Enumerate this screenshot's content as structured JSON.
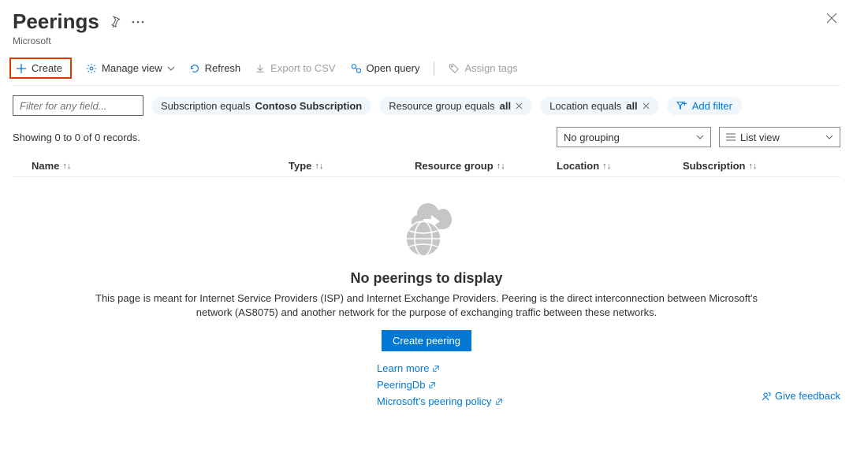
{
  "header": {
    "title": "Peerings",
    "subtitle": "Microsoft"
  },
  "toolbar": {
    "create": "Create",
    "manage_view": "Manage view",
    "refresh": "Refresh",
    "export_csv": "Export to CSV",
    "open_query": "Open query",
    "assign_tags": "Assign tags"
  },
  "filters": {
    "input_placeholder": "Filter for any field...",
    "subscription_prefix": "Subscription equals ",
    "subscription_value": "Contoso Subscription",
    "rg_prefix": "Resource group equals ",
    "rg_value": "all",
    "loc_prefix": "Location equals ",
    "loc_value": "all",
    "add_filter": "Add filter"
  },
  "controls": {
    "records_text": "Showing 0 to 0 of 0 records.",
    "grouping": "No grouping",
    "view": "List view"
  },
  "columns": {
    "name": "Name",
    "type": "Type",
    "rg": "Resource group",
    "location": "Location",
    "subscription": "Subscription"
  },
  "empty": {
    "title": "No peerings to display",
    "desc": "This page is meant for Internet Service Providers (ISP) and Internet Exchange Providers. Peering is the direct interconnection between Microsoft's network (AS8075) and another network for the purpose of exchanging traffic between these networks.",
    "cta": "Create peering",
    "learn_more": "Learn more",
    "peeringdb": "PeeringDb",
    "policy": "Microsoft's peering policy",
    "feedback": "Give feedback"
  }
}
